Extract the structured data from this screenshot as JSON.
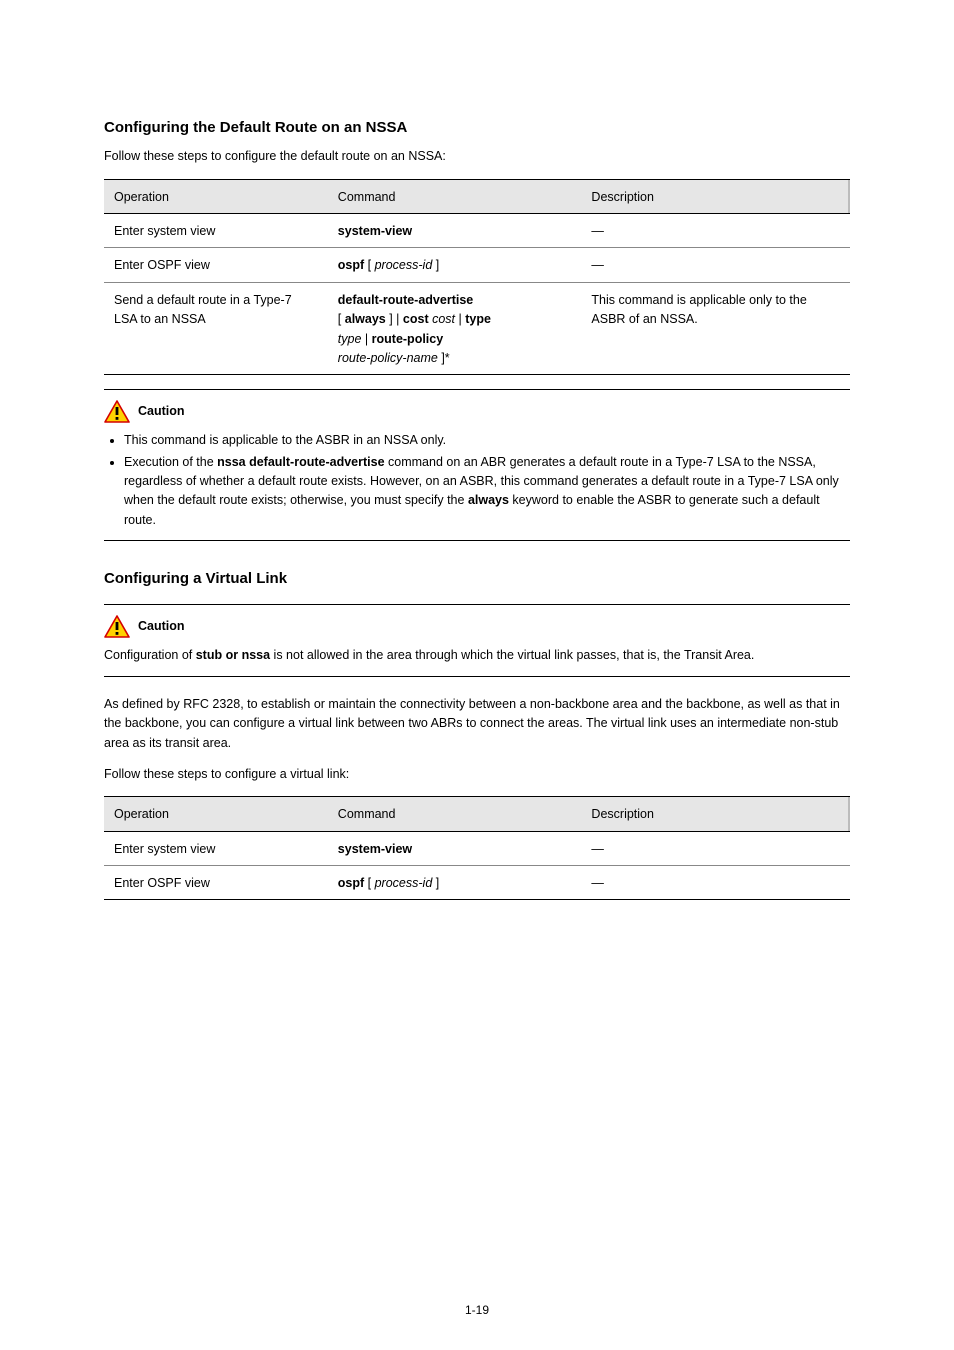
{
  "section1": {
    "heading": "Configuring the Default Route on an NSSA",
    "intro": "Follow these steps to configure the default route on an NSSA:",
    "table": {
      "headers": {
        "op": "Operation",
        "cmd": "Command",
        "desc": "Description"
      },
      "rows": [
        {
          "op": "Enter system view",
          "cmd_b": "system-view",
          "cmd_rest": "",
          "desc": "—"
        },
        {
          "op": "Enter OSPF view",
          "cmd_prefix_b": "ospf",
          "cmd_mid_plain": " [ ",
          "cmd_mid_i": "process-id",
          "cmd_mid_plain2": " ]",
          "desc": "—"
        },
        {
          "op": "Send a default route in a Type-7 LSA to an NSSA",
          "cmd_l1_b": "default-route-advertise",
          "cmd_l2_a": "[ ",
          "cmd_l2_b": "always",
          "cmd_l2_c": " ] | ",
          "cmd_l2_d": "cost",
          "cmd_l2_e": " cost",
          "cmd_l2_f": " | ",
          "cmd_l2_g": "type",
          "cmd_l3_a": "type",
          "cmd_l3_b": " | ",
          "cmd_l3_c": "route-policy",
          "cmd_l4_a": "route-policy-name",
          "cmd_l4_b": " ]*",
          "desc": "This command is applicable only to the ASBR of an NSSA."
        }
      ]
    },
    "callout": {
      "label": "Caution",
      "bullets": [
        "This command is applicable to the ASBR in an NSSA only.",
        {
          "pre": "Execution of the ",
          "b1": "nssa default-route-advertise",
          "mid1": " command on an ABR generates a default route in a Type-7 LSA to the NSSA, regardless of whether a default route exists. However, on an ASBR, this command generates a default route in a Type-7 LSA only when the default route exists; otherwise, you must specify the ",
          "b2": "always",
          "post": " keyword to enable the ASBR to generate such a default route."
        }
      ]
    }
  },
  "section2": {
    "heading": "Configuring a Virtual Link",
    "callout": {
      "label": "Caution",
      "text_pre": "Configuration of ",
      "text_b": "stub or nssa",
      "text_post": " is not allowed in the area through which the virtual link passes, that is, the Transit Area."
    },
    "para": "As defined by RFC 2328, to establish or maintain the connectivity between a non-backbone area and the backbone, as well as that in the backbone, you can configure a virtual link between two ABRs to connect the areas. The virtual link uses an intermediate non-stub area as its transit area.",
    "intro": "Follow these steps to configure a virtual link:",
    "table": {
      "headers": {
        "op": "Operation",
        "cmd": "Command",
        "desc": "Description"
      },
      "rows": [
        {
          "op": "Enter system view",
          "cmd_b": "system-view",
          "desc": "—"
        },
        {
          "op_pre": "",
          "op": "Enter OSPF view",
          "cmd_prefix_b": "ospf",
          "cmd_mid_plain": " [ ",
          "cmd_mid_i": "process-id",
          "cmd_mid_plain2": " ]",
          "desc": "—"
        }
      ]
    }
  },
  "pageNumber": "1-19"
}
